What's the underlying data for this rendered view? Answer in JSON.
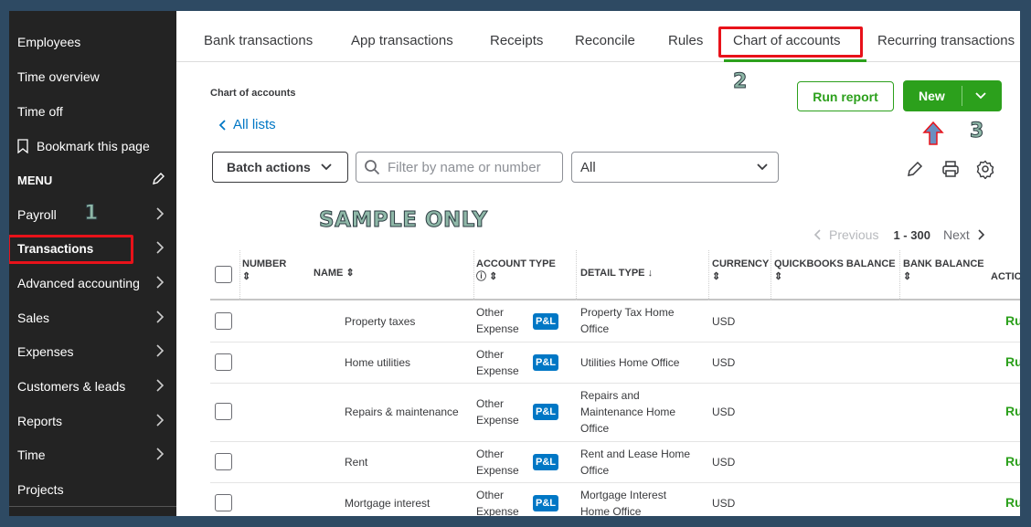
{
  "sidebar": {
    "items": [
      {
        "label": "Employees",
        "chevron": false
      },
      {
        "label": "Time overview",
        "chevron": false
      },
      {
        "label": "Time off",
        "chevron": false
      },
      {
        "label": "Bookmark this page",
        "chevron": false
      },
      {
        "label": "MENU",
        "chevron": false
      },
      {
        "label": "Payroll",
        "chevron": true
      },
      {
        "label": "Transactions",
        "chevron": true
      },
      {
        "label": "Advanced accounting",
        "chevron": true
      },
      {
        "label": "Sales",
        "chevron": true
      },
      {
        "label": "Expenses",
        "chevron": true
      },
      {
        "label": "Customers & leads",
        "chevron": true
      },
      {
        "label": "Reports",
        "chevron": true
      },
      {
        "label": "Time",
        "chevron": true
      },
      {
        "label": "Projects",
        "chevron": false
      }
    ]
  },
  "annotations": {
    "step1": "1",
    "step2": "2",
    "step3": "3",
    "watermark": "SAMPLE ONLY"
  },
  "tabs": [
    "Bank transactions",
    "App transactions",
    "Receipts",
    "Reconcile",
    "Rules",
    "Chart of accounts",
    "Recurring transactions"
  ],
  "page": {
    "title": "Chart of accounts",
    "back_link": "All lists",
    "run_report": "Run report",
    "new_label": "New",
    "batch_actions": "Batch actions",
    "filter_placeholder": "Filter by name or number",
    "filter_value": "",
    "select_value": "All"
  },
  "pager": {
    "previous": "Previous",
    "range": "1 - 300",
    "next": "Next"
  },
  "table": {
    "headers": {
      "number": "NUMBER",
      "name": "NAME",
      "account_type": "ACCOUNT TYPE",
      "detail_type": "DETAIL TYPE",
      "currency": "CURRENCY",
      "qb_balance": "QUICKBOOKS BALANCE",
      "bank_balance": "BANK BALANCE",
      "action": "ACTIO"
    },
    "rows": [
      {
        "number": "",
        "name": "Property taxes",
        "type_line1": "Other",
        "type_line2": "Expense",
        "badge": "P&L",
        "detail": [
          "Property Tax Home",
          "Office"
        ],
        "currency": "USD",
        "action": "Ru"
      },
      {
        "number": "",
        "name": "Home utilities",
        "type_line1": "Other",
        "type_line2": "Expense",
        "badge": "P&L",
        "detail": [
          "Utilities Home Office"
        ],
        "currency": "USD",
        "action": "Ru"
      },
      {
        "number": "",
        "name": "Repairs & maintenance",
        "type_line1": "Other",
        "type_line2": "Expense",
        "badge": "P&L",
        "detail": [
          "Repairs and",
          "Maintenance Home",
          "Office"
        ],
        "currency": "USD",
        "action": "Ru"
      },
      {
        "number": "",
        "name": "Rent",
        "type_line1": "Other",
        "type_line2": "Expense",
        "badge": "P&L",
        "detail": [
          "Rent and Lease Home",
          "Office"
        ],
        "currency": "USD",
        "action": "Ru"
      },
      {
        "number": "",
        "name": "Mortgage interest",
        "type_line1": "Other",
        "type_line2": "Expense",
        "badge": "P&L",
        "detail": [
          "Mortgage Interest",
          "Home Office"
        ],
        "currency": "USD",
        "action": "Ru"
      }
    ]
  },
  "colors": {
    "accent_green": "#2ca01c",
    "link_blue": "#0077c5",
    "sidebar_bg": "#232323",
    "highlight_red": "#e8121a"
  }
}
